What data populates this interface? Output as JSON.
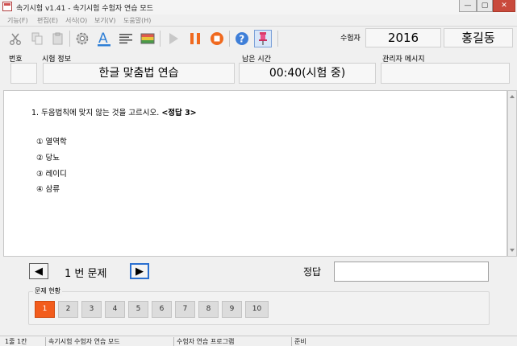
{
  "window": {
    "title": "속기시험 v1.41 - 속기시험 수험자 연습 모드",
    "minimize": "—",
    "maximize": "▢",
    "close": "✕"
  },
  "menu": [
    "기능(F)",
    "편집(E)",
    "서식(O)",
    "보기(V)",
    "도움말(H)"
  ],
  "examinee": {
    "label": "수험자",
    "number": "2016",
    "name": "홍길동"
  },
  "info": {
    "headers": {
      "no": "번호",
      "exam": "시험 정보",
      "time": "남은 시간",
      "admin": "관리자 메시지"
    },
    "exam_name": "한글 맞춤법 연습",
    "remaining": "00:40(시험 중)",
    "no_value": "",
    "admin_value": ""
  },
  "question": {
    "text": "1. 두음법칙에 맞지 않는 것을 고르시오.",
    "answer_tag": "<정답 3>",
    "options": [
      "① 열역학",
      "② 당뇨",
      "③ 레이디",
      "④ 삼류"
    ]
  },
  "nav": {
    "prev": "◀",
    "next": "▶",
    "question_label": "1 번 문제",
    "answer_label": "정답",
    "answer_value": ""
  },
  "status": {
    "title": "문제 현황",
    "numbers": [
      "1",
      "2",
      "3",
      "4",
      "5",
      "6",
      "7",
      "8",
      "9",
      "10"
    ],
    "current": "1"
  },
  "statusbar": [
    "1줄 1칸",
    "속기시험 수험자 연습 모드",
    "수험자 연습 프로그램",
    "준비"
  ],
  "colors": {
    "current_question": "#f25c1c",
    "accent": "#2a6fd0"
  },
  "icons": [
    "cut-icon",
    "copy-icon",
    "paste-icon",
    "settings-icon",
    "font-color-icon",
    "align-icon",
    "color-palette-icon",
    "play-icon",
    "pause-icon",
    "stop-icon",
    "help-icon",
    "pin-icon"
  ]
}
